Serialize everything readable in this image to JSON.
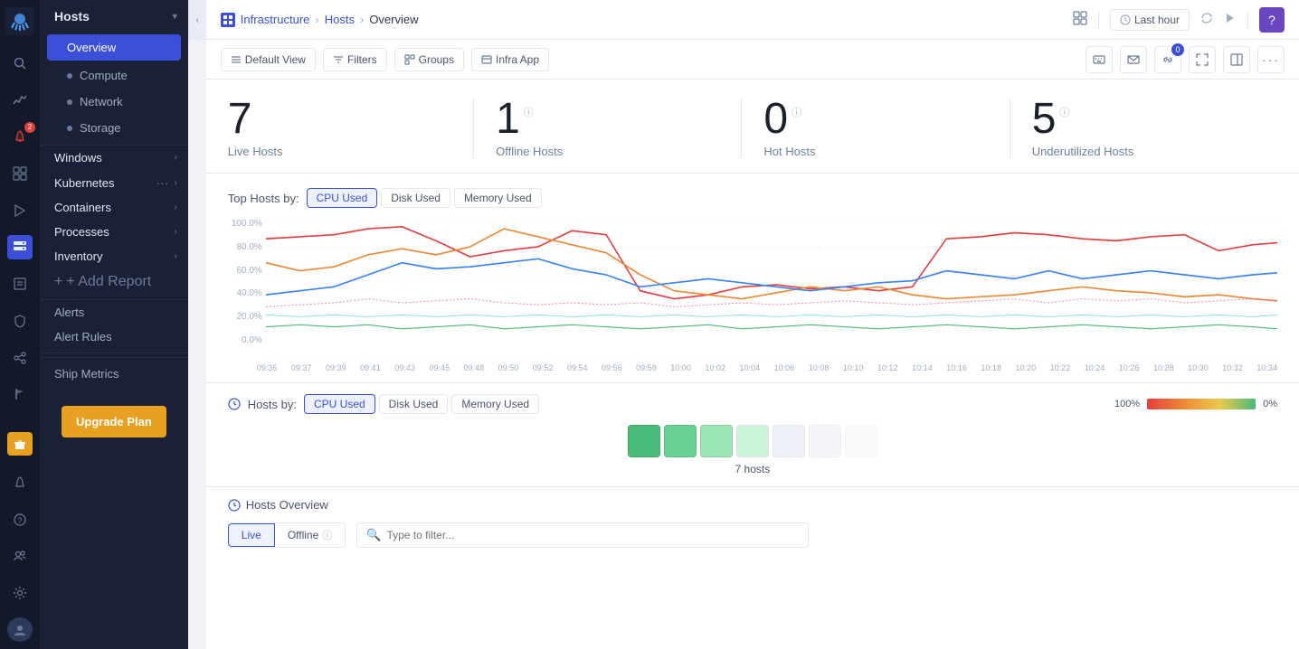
{
  "sidebar": {
    "logo_icon": "octopus-logo",
    "nav_items": [
      {
        "id": "search",
        "icon": "🔍",
        "label": "Search"
      },
      {
        "id": "apm",
        "icon": "📈",
        "label": "APM"
      },
      {
        "id": "alerts",
        "icon": "🔔",
        "label": "Alerts",
        "badge": "2"
      },
      {
        "id": "dashboards",
        "icon": "⊞",
        "label": "Dashboards"
      },
      {
        "id": "events",
        "icon": "⚑",
        "label": "Events"
      },
      {
        "id": "infra",
        "icon": "🖥",
        "label": "Infrastructure",
        "active": true
      },
      {
        "id": "logs",
        "icon": "📋",
        "label": "Logs"
      },
      {
        "id": "security",
        "icon": "🛡",
        "label": "Security"
      },
      {
        "id": "integrations",
        "icon": "🔗",
        "label": "Integrations"
      },
      {
        "id": "flag",
        "icon": "⚑",
        "label": "Feature Flags"
      },
      {
        "id": "gift",
        "icon": "🎁",
        "label": "Gift",
        "special": "gift"
      },
      {
        "id": "bell2",
        "icon": "🔔",
        "label": "Notifications"
      },
      {
        "id": "question",
        "icon": "?",
        "label": "Help"
      },
      {
        "id": "team",
        "icon": "👥",
        "label": "Team"
      },
      {
        "id": "settings",
        "icon": "⚙",
        "label": "Settings"
      },
      {
        "id": "avatar",
        "icon": "👤",
        "label": "Profile"
      }
    ],
    "hosts_dropdown": {
      "label": "Hosts",
      "items": [
        {
          "id": "overview",
          "label": "Overview",
          "active": true
        },
        {
          "id": "compute",
          "label": "Compute"
        },
        {
          "id": "network",
          "label": "Network"
        },
        {
          "id": "storage",
          "label": "Storage"
        }
      ]
    },
    "groups": [
      {
        "label": "Windows",
        "has_arrow": true
      },
      {
        "label": "Kubernetes",
        "has_arrow": true,
        "has_dots": true
      },
      {
        "label": "Containers",
        "has_arrow": true
      },
      {
        "label": "Processes",
        "has_arrow": true
      },
      {
        "label": "Inventory",
        "has_arrow": true
      }
    ],
    "add_report_label": "+ Add Report",
    "alerts_items": [
      "Alerts",
      "Alert Rules"
    ],
    "ship_metrics_label": "Ship Metrics",
    "upgrade_label": "Upgrade Plan"
  },
  "topbar": {
    "breadcrumb": {
      "infra": "Infrastructure",
      "hosts": "Hosts",
      "current": "Overview"
    },
    "last_hour_label": "Last hour",
    "question_icon": "?",
    "grid_icon": "⊞"
  },
  "toolbar": {
    "default_view_label": "Default View",
    "filters_label": "Filters",
    "groups_label": "Groups",
    "infra_app_label": "Infra App",
    "icons": [
      "keyboard",
      "mail",
      "link",
      "fullscreen",
      "layout",
      "more"
    ],
    "link_badge": "0"
  },
  "stats": [
    {
      "number": "7",
      "label": "Live Hosts",
      "has_info": false
    },
    {
      "number": "1",
      "label": "Offline Hosts",
      "has_info": true
    },
    {
      "number": "0",
      "label": "Hot Hosts",
      "has_info": true
    },
    {
      "number": "5",
      "label": "Underutilized Hosts",
      "has_info": true
    }
  ],
  "top_hosts": {
    "label": "Top Hosts by:",
    "tabs": [
      "CPU Used",
      "Disk Used",
      "Memory Used"
    ],
    "active_tab": "CPU Used",
    "y_labels": [
      "100.0%",
      "80.0%",
      "60.0%",
      "40.0%",
      "20.0%",
      "0.0%"
    ],
    "x_labels": [
      "09:35",
      "09:37",
      "09:39",
      "09:41",
      "09:43",
      "09:45",
      "09:48",
      "09:50",
      "09:52",
      "09:54",
      "09:56",
      "09:58",
      "10:00",
      "10:02",
      "10:04",
      "10:06",
      "10:08",
      "10:10",
      "10:12",
      "10:14",
      "10:16",
      "10:18",
      "10:20",
      "10:22",
      "10:24",
      "10:26",
      "10:28",
      "10:30",
      "10:32",
      "10:34"
    ]
  },
  "hosts_by": {
    "label": "Hosts by:",
    "tabs": [
      "CPU Used",
      "Disk Used",
      "Memory Used"
    ],
    "active_tab": "CPU Used",
    "legend_left": "100%",
    "legend_right": "0%"
  },
  "heatmap": {
    "boxes": [
      {
        "color": "#48bb78",
        "opacity": 1
      },
      {
        "color": "#48bb78",
        "opacity": 0.8
      },
      {
        "color": "#48bb78",
        "opacity": 0.6
      },
      {
        "color": "#e2e8f0",
        "opacity": 0.5
      },
      {
        "color": "#e2e8f0",
        "opacity": 0.4
      },
      {
        "color": "#e2e8f0",
        "opacity": 0.3
      },
      {
        "color": "#e2e8f0",
        "opacity": 0.2
      }
    ],
    "count_label": "7 hosts"
  },
  "hosts_overview": {
    "title": "Hosts Overview",
    "live_label": "Live",
    "offline_label": "Offline",
    "filter_placeholder": "Type to filter..."
  }
}
